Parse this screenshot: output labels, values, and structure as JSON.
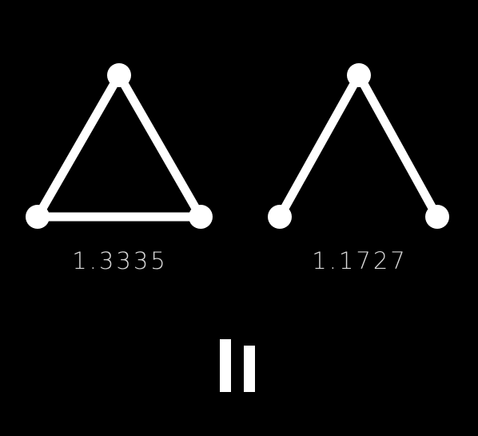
{
  "colors": {
    "background": "#000000",
    "shape": "#ffffff",
    "score_text": "#d9d9d9"
  },
  "shapes": [
    {
      "name": "closed-triangle",
      "closed": true,
      "score": "1.3335"
    },
    {
      "name": "open-chevron",
      "closed": false,
      "score": "1.1727"
    }
  ],
  "controls": {
    "pause_icon": "pause-icon"
  }
}
